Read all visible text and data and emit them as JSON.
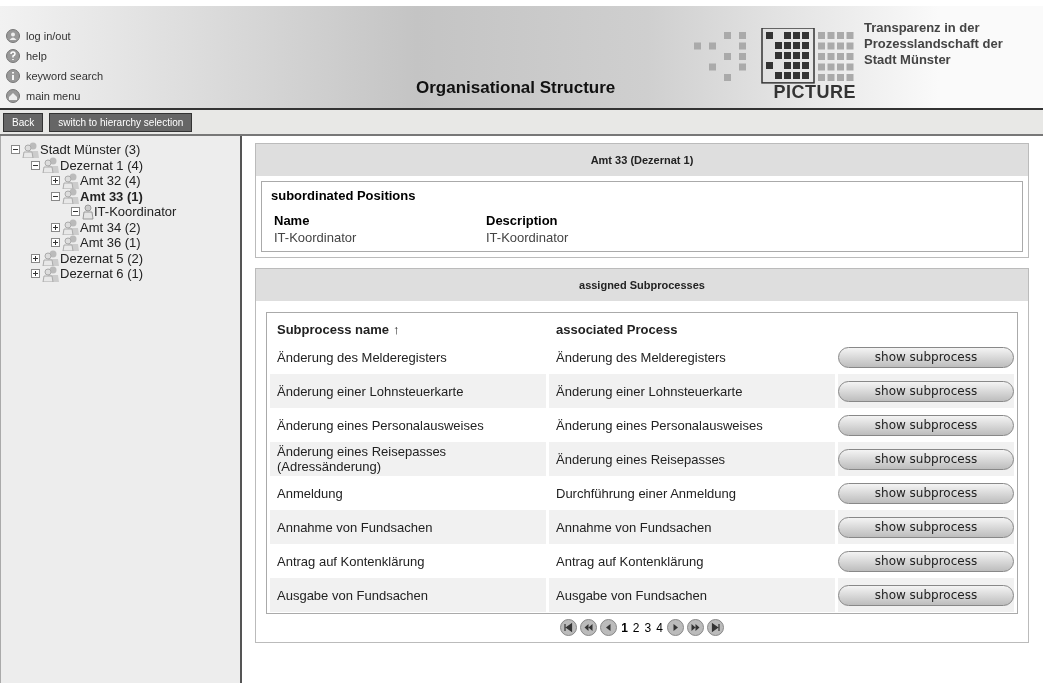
{
  "header": {
    "links": [
      {
        "label": "log in/out",
        "kind": "user"
      },
      {
        "label": "help",
        "kind": "help"
      },
      {
        "label": "keyword search",
        "kind": "info"
      },
      {
        "label": "main menu",
        "kind": "home"
      }
    ],
    "title": "Organisational Structure",
    "logo_text": "PICTURE",
    "tagline": [
      "Transparenz in der",
      "Prozesslandschaft der",
      "Stadt Münster"
    ]
  },
  "toolbar": {
    "buttons": [
      "Back",
      "switch to hierarchy selection"
    ]
  },
  "tree": [
    {
      "label": "Stadt Münster (3)",
      "kind": "unit",
      "expanded": true,
      "selected": false,
      "children": [
        {
          "label": "Dezernat 1 (4)",
          "kind": "unit",
          "expanded": true,
          "selected": false,
          "children": [
            {
              "label": "Amt 32 (4)",
              "kind": "unit",
              "expanded": false,
              "selected": false
            },
            {
              "label": "Amt 33 (1)",
              "kind": "unit",
              "expanded": true,
              "selected": true,
              "children": [
                {
                  "label": "IT-Koordinator",
                  "kind": "position",
                  "expanded": true,
                  "selected": false
                }
              ]
            },
            {
              "label": "Amt 34 (2)",
              "kind": "unit",
              "expanded": false,
              "selected": false
            },
            {
              "label": "Amt 36 (1)",
              "kind": "unit",
              "expanded": false,
              "selected": false
            }
          ]
        },
        {
          "label": "Dezernat 5 (2)",
          "kind": "unit",
          "expanded": false,
          "selected": false
        },
        {
          "label": "Dezernat 6 (1)",
          "kind": "unit",
          "expanded": false,
          "selected": false
        }
      ]
    }
  ],
  "unit_panel": {
    "title": "Amt 33 (Dezernat 1)",
    "section_title": "subordinated Positions",
    "columns": [
      "Name",
      "Description"
    ],
    "rows": [
      [
        "IT-Koordinator",
        "IT-Koordinator"
      ]
    ]
  },
  "subprocess_panel": {
    "title": "assigned Subprocesses",
    "columns": [
      "Subprocess name",
      "associated Process"
    ],
    "sort_indicator": "↑",
    "rows": [
      {
        "subprocess": "Änderung des Melderegisters",
        "process": "Änderung des Melderegisters",
        "action": "show subprocess"
      },
      {
        "subprocess": "Änderung einer Lohnsteuerkarte",
        "process": "Änderung einer Lohnsteuerkarte",
        "action": "show subprocess"
      },
      {
        "subprocess": "Änderung eines Personalausweises",
        "process": "Änderung eines Personalausweises",
        "action": "show subprocess"
      },
      {
        "subprocess": "Änderung eines Reisepasses (Adressänderung)",
        "process": "Änderung eines Reisepasses",
        "action": "show subprocess"
      },
      {
        "subprocess": "Anmeldung",
        "process": "Durchführung einer Anmeldung",
        "action": "show subprocess"
      },
      {
        "subprocess": "Annahme von Fundsachen",
        "process": "Annahme von Fundsachen",
        "action": "show subprocess"
      },
      {
        "subprocess": "Antrag auf Kontenklärung",
        "process": "Antrag auf Kontenklärung",
        "action": "show subprocess"
      },
      {
        "subprocess": "Ausgabe von Fundsachen",
        "process": "Ausgabe von Fundsachen",
        "action": "show subprocess"
      }
    ],
    "pagination": {
      "pages": [
        {
          "label": "1",
          "selected": true
        },
        {
          "label": "2",
          "selected": false
        },
        {
          "label": "3",
          "selected": false
        },
        {
          "label": "4",
          "selected": false
        }
      ]
    }
  }
}
